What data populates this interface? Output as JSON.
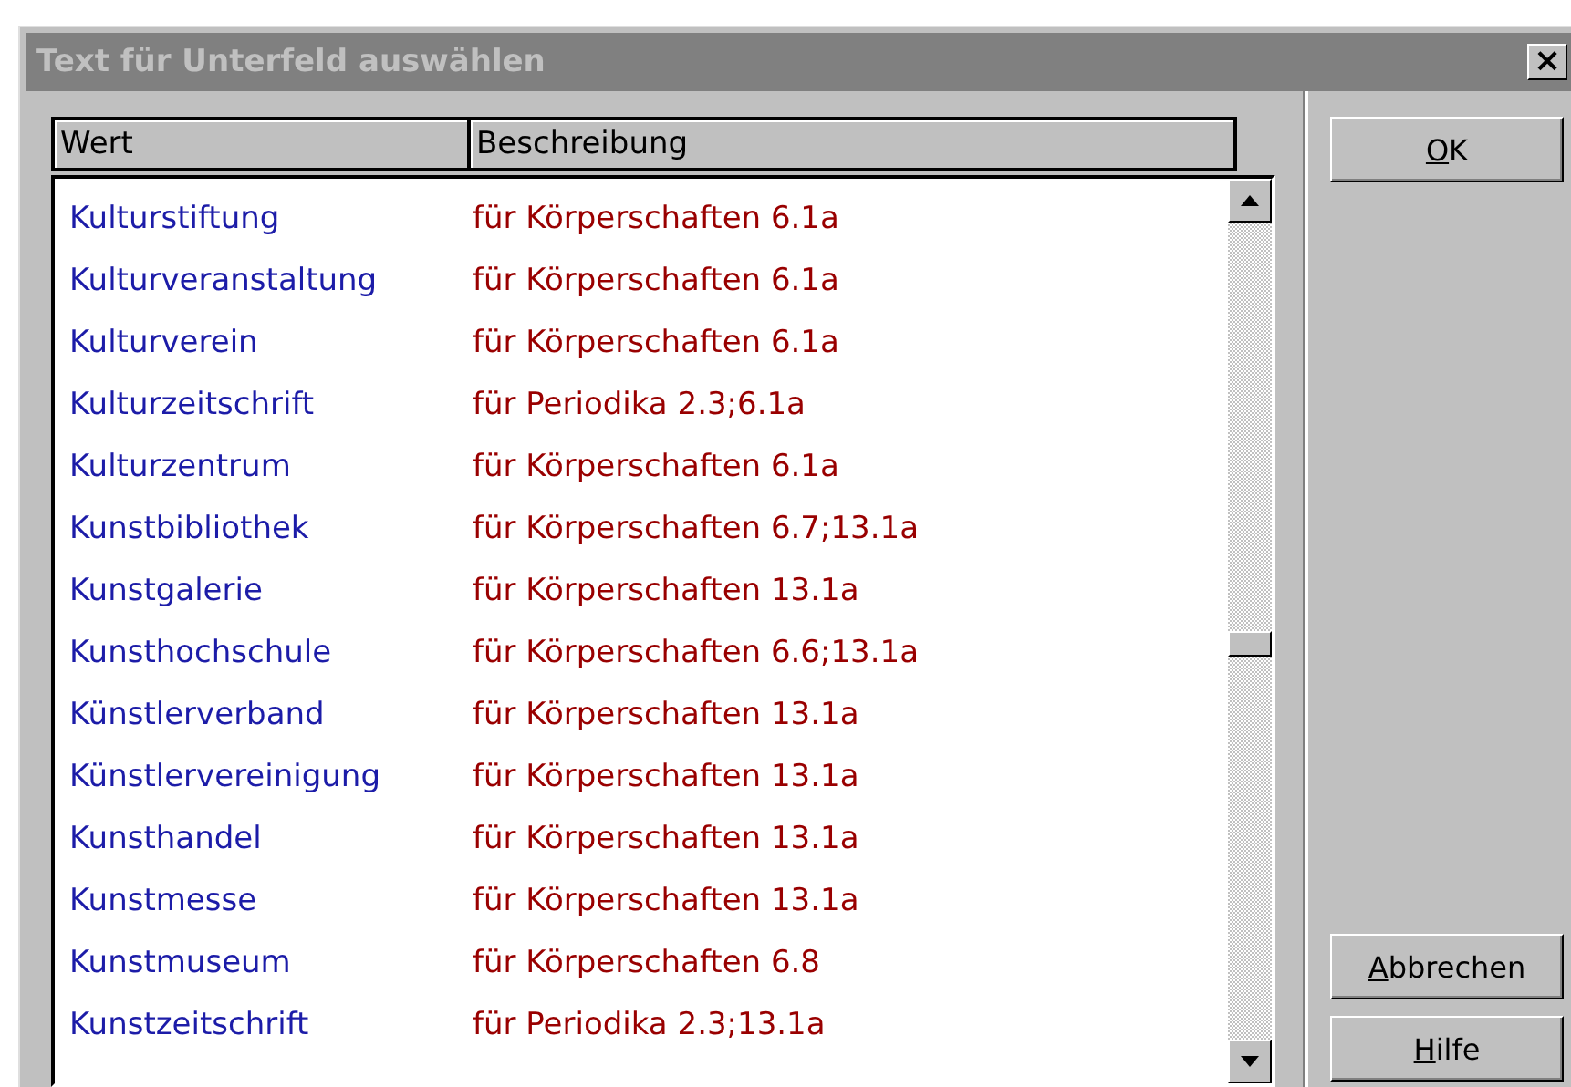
{
  "window": {
    "title": "Text für Unterfeld auswählen",
    "close": "×"
  },
  "table": {
    "columns": [
      "Wert",
      "Beschreibung"
    ],
    "rows": [
      {
        "value": "Kulturstiftung",
        "description": "für Körperschaften 6.1a"
      },
      {
        "value": "Kulturveranstaltung",
        "description": "für Körperschaften 6.1a"
      },
      {
        "value": "Kulturverein",
        "description": "für Körperschaften 6.1a"
      },
      {
        "value": "Kulturzeitschrift",
        "description": "für Periodika 2.3;6.1a"
      },
      {
        "value": "Kulturzentrum",
        "description": "für Körperschaften 6.1a"
      },
      {
        "value": "Kunstbibliothek",
        "description": "für Körperschaften 6.7;13.1a"
      },
      {
        "value": "Kunstgalerie",
        "description": "für Körperschaften 13.1a"
      },
      {
        "value": "Kunsthochschule",
        "description": "für Körperschaften 6.6;13.1a"
      },
      {
        "value": "Künstlerverband",
        "description": "für Körperschaften 13.1a"
      },
      {
        "value": "Künstlervereinigung",
        "description": "für Körperschaften 13.1a"
      },
      {
        "value": "Kunsthandel",
        "description": "für Körperschaften 13.1a"
      },
      {
        "value": "Kunstmesse",
        "description": "für Körperschaften 13.1a"
      },
      {
        "value": "Kunstmuseum",
        "description": "für Körperschaften 6.8"
      },
      {
        "value": "Kunstzeitschrift",
        "description": "für Periodika 2.3;13.1a"
      }
    ]
  },
  "buttons": [
    {
      "label": "OK",
      "first_letter_underlined": true,
      "kind": "top"
    },
    {
      "label": "Abbrechen",
      "first_letter_underlined": true,
      "kind": "bottom"
    },
    {
      "label": "Hilfe",
      "first_letter_underlined": true,
      "kind": "bottom"
    }
  ]
}
